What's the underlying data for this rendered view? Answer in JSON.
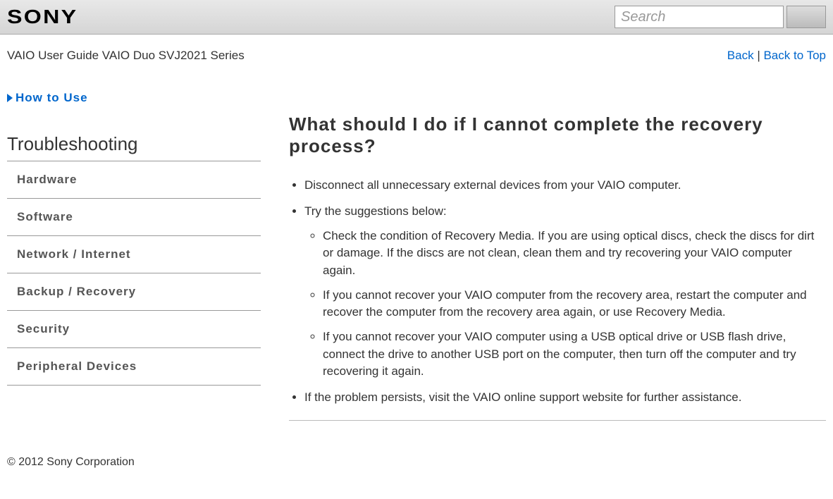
{
  "header": {
    "logo_text": "SONY",
    "search_placeholder": "Search"
  },
  "breadcrumb": "VAIO User Guide VAIO Duo SVJ2021 Series",
  "top_links": {
    "back": "Back",
    "separator": " | ",
    "back_to_top": "Back to Top"
  },
  "sidebar": {
    "how_to_use": "How to Use",
    "section_title": "Troubleshooting",
    "items": [
      {
        "label": "Hardware"
      },
      {
        "label": "Software"
      },
      {
        "label": "Network / Internet"
      },
      {
        "label": "Backup / Recovery"
      },
      {
        "label": "Security"
      },
      {
        "label": "Peripheral Devices"
      }
    ]
  },
  "article": {
    "title": "What should I do if I cannot complete the recovery process?",
    "bullets": {
      "b1": "Disconnect all unnecessary external devices from your VAIO computer.",
      "b2": "Try the suggestions below:",
      "b2_sub": {
        "s1": "Check the condition of Recovery Media. If you are using optical discs, check the discs for dirt or damage. If the discs are not clean, clean them and try recovering your VAIO computer again.",
        "s2": "If you cannot recover your VAIO computer from the recovery area, restart the computer and recover the computer from the recovery area again, or use Recovery Media.",
        "s3": "If you cannot recover your VAIO computer using a USB optical drive or USB flash drive, connect the drive to another USB port on the computer, then turn off the computer and try recovering it again."
      },
      "b3": "If the problem persists, visit the VAIO online support website for further assistance."
    }
  },
  "footer": {
    "copyright": "© 2012 Sony Corporation"
  }
}
